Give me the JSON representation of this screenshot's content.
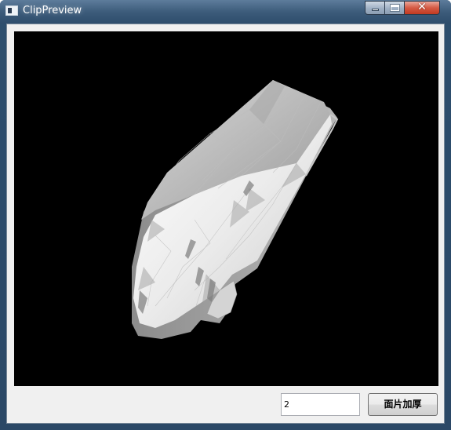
{
  "window": {
    "title": "ClipPreview",
    "icon": "window-app-icon",
    "controls": {
      "minimize_icon": "minimize-icon",
      "maximize_icon": "maximize-icon",
      "close_glyph": "✕"
    }
  },
  "viewport": {
    "background": "#000000",
    "content": "3d-mesh-preview",
    "mesh_color": "#ffffff"
  },
  "footer": {
    "thickness_value": "2",
    "thicken_button_label": "面片加厚"
  }
}
